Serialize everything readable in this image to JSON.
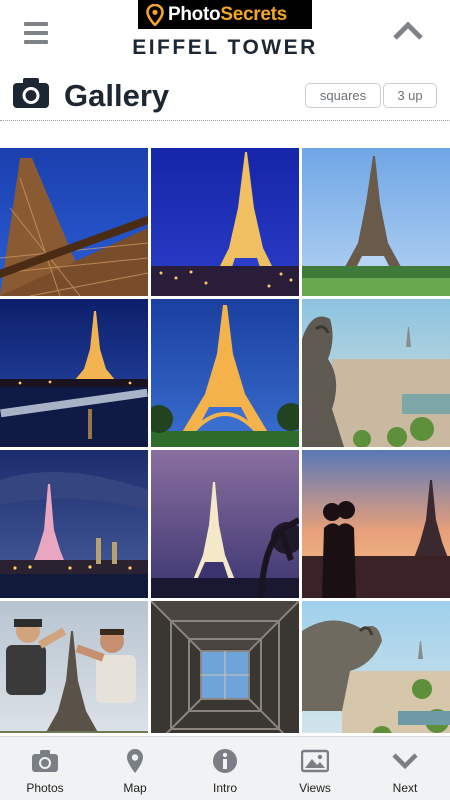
{
  "header": {
    "logo_text": "PhotoSecrets",
    "title": "EIFFEL TOWER"
  },
  "gallery": {
    "title": "Gallery",
    "view_options": [
      "squares",
      "3 up"
    ]
  },
  "photos": [
    {
      "subject": "eiffel-tower-from-below-day"
    },
    {
      "subject": "eiffel-tower-lit-at-night"
    },
    {
      "subject": "eiffel-tower-champ-de-mars"
    },
    {
      "subject": "eiffel-tower-over-seine-dusk"
    },
    {
      "subject": "eiffel-tower-golden-lights"
    },
    {
      "subject": "gargoyle-over-paris"
    },
    {
      "subject": "eiffel-tower-pont-alexandre-iii"
    },
    {
      "subject": "eiffel-tower-long-exposure-night"
    },
    {
      "subject": "couple-silhouette-sunset"
    },
    {
      "subject": "tourists-posing-with-tower"
    },
    {
      "subject": "eiffel-tower-lattice-looking-up"
    },
    {
      "subject": "notre-dame-gargoyle-view"
    }
  ],
  "nav": {
    "items": [
      {
        "label": "Photos",
        "icon": "camera-icon"
      },
      {
        "label": "Map",
        "icon": "map-pin-icon"
      },
      {
        "label": "Intro",
        "icon": "info-icon"
      },
      {
        "label": "Views",
        "icon": "image-icon"
      },
      {
        "label": "Next",
        "icon": "chevron-down-icon"
      }
    ]
  },
  "colors": {
    "brand_black": "#000000",
    "brand_accent": "#f5a623",
    "title_text": "#1d2733",
    "nav_background": "#f1f2f3"
  }
}
